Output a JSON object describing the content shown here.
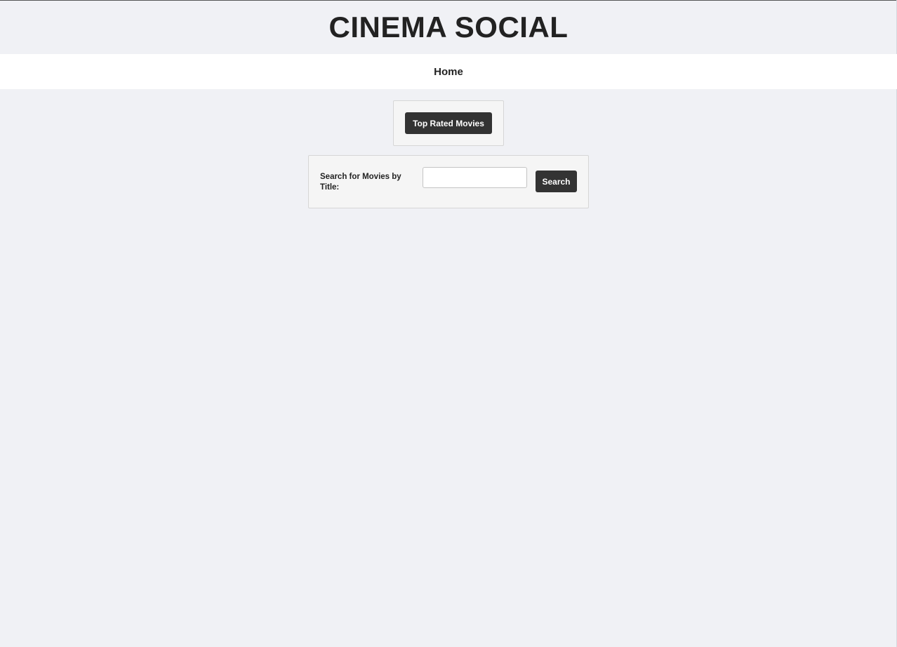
{
  "header": {
    "title": "CINEMA SOCIAL"
  },
  "nav": {
    "home_label": "Home"
  },
  "top_rated": {
    "button_label": "Top Rated Movies"
  },
  "search": {
    "label": "Search for Movies by Title:",
    "input_value": "",
    "placeholder": "",
    "button_label": "Search"
  },
  "colors": {
    "page_background": "#f0f1f5",
    "nav_background": "#ffffff",
    "button_background": "#333333",
    "panel_background": "#f5f5f5"
  }
}
